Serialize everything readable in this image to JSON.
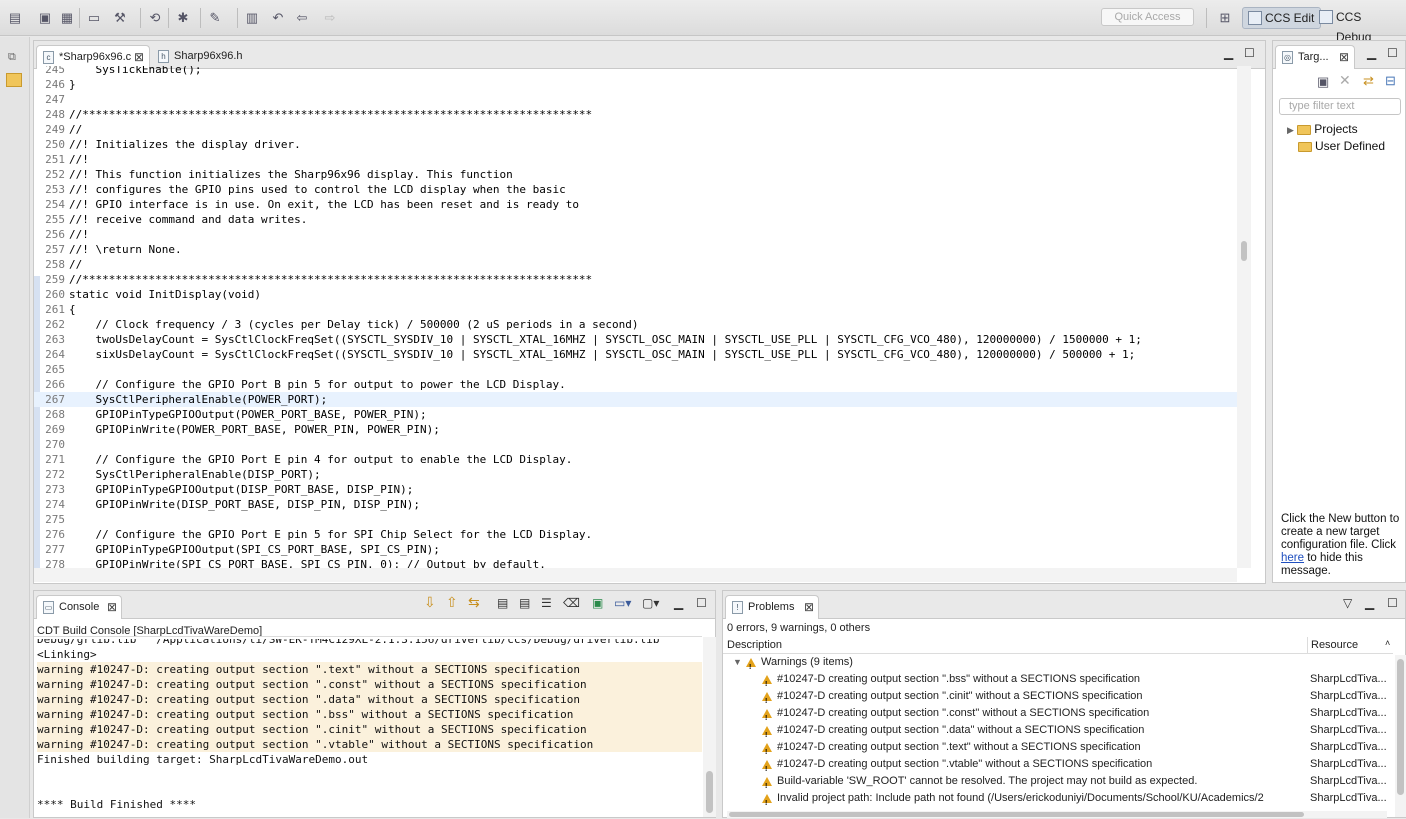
{
  "toolbar": {
    "quick_access_placeholder": "Quick Access",
    "perspectives": [
      {
        "label": "CCS Edit",
        "active": true
      },
      {
        "label": "CCS Debug",
        "active": false
      }
    ]
  },
  "editor": {
    "tabs": [
      {
        "label": "*Sharp96x96.c",
        "active": true
      },
      {
        "label": "Sharp96x96.h",
        "active": false
      }
    ],
    "lines": [
      {
        "n": "245",
        "t": "    SysTickEnable();",
        "k": "fn"
      },
      {
        "n": "246",
        "t": "}",
        "k": "plain"
      },
      {
        "n": "247",
        "t": "",
        "k": "plain"
      },
      {
        "n": "248",
        "t": "//*****************************************************************************",
        "k": "com"
      },
      {
        "n": "249",
        "t": "//",
        "k": "com"
      },
      {
        "n": "250",
        "t": "//! Initializes the display driver.",
        "k": "com"
      },
      {
        "n": "251",
        "t": "//!",
        "k": "com"
      },
      {
        "n": "252",
        "t": "//! This function initializes the Sharp96x96 display. This function",
        "k": "com"
      },
      {
        "n": "253",
        "t": "//! configures the GPIO pins used to control the LCD display when the basic",
        "k": "com"
      },
      {
        "n": "254",
        "t": "//! GPIO interface is in use. On exit, the LCD has been reset and is ready to",
        "k": "com"
      },
      {
        "n": "255",
        "t": "//! receive command and data writes.",
        "k": "com"
      },
      {
        "n": "256",
        "t": "//!",
        "k": "com"
      },
      {
        "n": "257",
        "t": "//! \\return None.",
        "k": "com"
      },
      {
        "n": "258",
        "t": "//",
        "k": "com"
      },
      {
        "n": "259",
        "t": "//*****************************************************************************",
        "k": "com"
      },
      {
        "n": "260",
        "t": "static void InitDisplay(void)",
        "k": "decl"
      },
      {
        "n": "261",
        "t": "{",
        "k": "plain"
      },
      {
        "n": "262",
        "t": "    // Clock frequency / 3 (cycles per Delay tick) / 500000 (2 uS periods in a second)",
        "k": "com"
      },
      {
        "n": "263",
        "t": "    twoUsDelayCount = SysCtlClockFreqSet((SYSCTL_SYSDIV_10 | SYSCTL_XTAL_16MHZ | SYSCTL_OSC_MAIN | SYSCTL_USE_PLL | SYSCTL_CFG_VCO_480), 120000000) / 1500000 + 1;",
        "k": "assign"
      },
      {
        "n": "264",
        "t": "    sixUsDelayCount = SysCtlClockFreqSet((SYSCTL_SYSDIV_10 | SYSCTL_XTAL_16MHZ | SYSCTL_OSC_MAIN | SYSCTL_USE_PLL | SYSCTL_CFG_VCO_480), 120000000) / 500000 + 1;",
        "k": "assign"
      },
      {
        "n": "265",
        "t": "",
        "k": "plain"
      },
      {
        "n": "266",
        "t": "    // Configure the GPIO Port B pin 5 for output to power the LCD Display.",
        "k": "com"
      },
      {
        "n": "267",
        "t": "    SysCtlPeripheralEnable(POWER_PORT);",
        "k": "fn",
        "current": true
      },
      {
        "n": "268",
        "t": "    GPIOPinTypeGPIOOutput(POWER_PORT_BASE, POWER_PIN);",
        "k": "fn"
      },
      {
        "n": "269",
        "t": "    GPIOPinWrite(POWER_PORT_BASE, POWER_PIN, POWER_PIN);",
        "k": "fn"
      },
      {
        "n": "270",
        "t": "",
        "k": "plain"
      },
      {
        "n": "271",
        "t": "    // Configure the GPIO Port E pin 4 for output to enable the LCD Display.",
        "k": "com"
      },
      {
        "n": "272",
        "t": "    SysCtlPeripheralEnable(DISP_PORT);",
        "k": "fn"
      },
      {
        "n": "273",
        "t": "    GPIOPinTypeGPIOOutput(DISP_PORT_BASE, DISP_PIN);",
        "k": "fn"
      },
      {
        "n": "274",
        "t": "    GPIOPinWrite(DISP_PORT_BASE, DISP_PIN, DISP_PIN);",
        "k": "fn"
      },
      {
        "n": "275",
        "t": "",
        "k": "plain"
      },
      {
        "n": "276",
        "t": "    // Configure the GPIO Port E pin 5 for SPI Chip Select for the LCD Display.",
        "k": "com"
      },
      {
        "n": "277",
        "t": "    GPIOPinTypeGPIOOutput(SPI_CS_PORT_BASE, SPI_CS_PIN);",
        "k": "fn"
      },
      {
        "n": "278",
        "t": "    GPIOPinWrite(SPI_CS_PORT_BASE, SPI_CS_PIN, 0); // Output by default.",
        "k": "fnc"
      }
    ]
  },
  "console": {
    "title": "Console",
    "subtitle": "CDT Build Console [SharpLcdTivaWareDemo]",
    "lines": [
      {
        "t": "Debug/grlib.lib\" \"/Applications/ti/SW-EK-TM4C129XL-2.1.3.156/driverlib/ccs/Debug/driverlib.lib\"",
        "w": false
      },
      {
        "t": "<Linking>",
        "w": false
      },
      {
        "t": "warning #10247-D: creating output section \".text\" without a SECTIONS specification",
        "w": true
      },
      {
        "t": "warning #10247-D: creating output section \".const\" without a SECTIONS specification",
        "w": true
      },
      {
        "t": "warning #10247-D: creating output section \".data\" without a SECTIONS specification",
        "w": true
      },
      {
        "t": "warning #10247-D: creating output section \".bss\" without a SECTIONS specification",
        "w": true
      },
      {
        "t": "warning #10247-D: creating output section \".cinit\" without a SECTIONS specification",
        "w": true
      },
      {
        "t": "warning #10247-D: creating output section \".vtable\" without a SECTIONS specification",
        "w": true
      },
      {
        "t": "Finished building target: SharpLcdTivaWareDemo.out",
        "w": false
      },
      {
        "t": " ",
        "w": false
      },
      {
        "t": " ",
        "w": false
      },
      {
        "t": "**** Build Finished ****",
        "w": false
      }
    ]
  },
  "problems": {
    "title": "Problems",
    "summary": "0 errors, 9 warnings, 0 others",
    "col_description": "Description",
    "col_resource": "Resource",
    "group_label": "Warnings (9 items)",
    "items": [
      {
        "d": "#10247-D creating output section \".bss\" without a SECTIONS specification",
        "r": "SharpLcdTiva..."
      },
      {
        "d": "#10247-D creating output section \".cinit\" without a SECTIONS specification",
        "r": "SharpLcdTiva..."
      },
      {
        "d": "#10247-D creating output section \".const\" without a SECTIONS specification",
        "r": "SharpLcdTiva..."
      },
      {
        "d": "#10247-D creating output section \".data\" without a SECTIONS specification",
        "r": "SharpLcdTiva..."
      },
      {
        "d": "#10247-D creating output section \".text\" without a SECTIONS specification",
        "r": "SharpLcdTiva..."
      },
      {
        "d": "#10247-D creating output section \".vtable\" without a SECTIONS specification",
        "r": "SharpLcdTiva..."
      },
      {
        "d": "Build-variable 'SW_ROOT' cannot be resolved. The project may not build as expected.",
        "r": "SharpLcdTiva..."
      },
      {
        "d": "Invalid project path: Include path not found (/Users/erickoduniyi/Documents/School/KU/Academics/2",
        "r": "SharpLcdTiva..."
      }
    ]
  },
  "target": {
    "tab_label": "Targ...",
    "filter_placeholder": "type filter text",
    "tree": [
      "Projects",
      "User Defined"
    ],
    "help_pre": "Click the New button to create a new target configuration file. Click ",
    "help_link": "here",
    "help_post": " to hide this message."
  }
}
